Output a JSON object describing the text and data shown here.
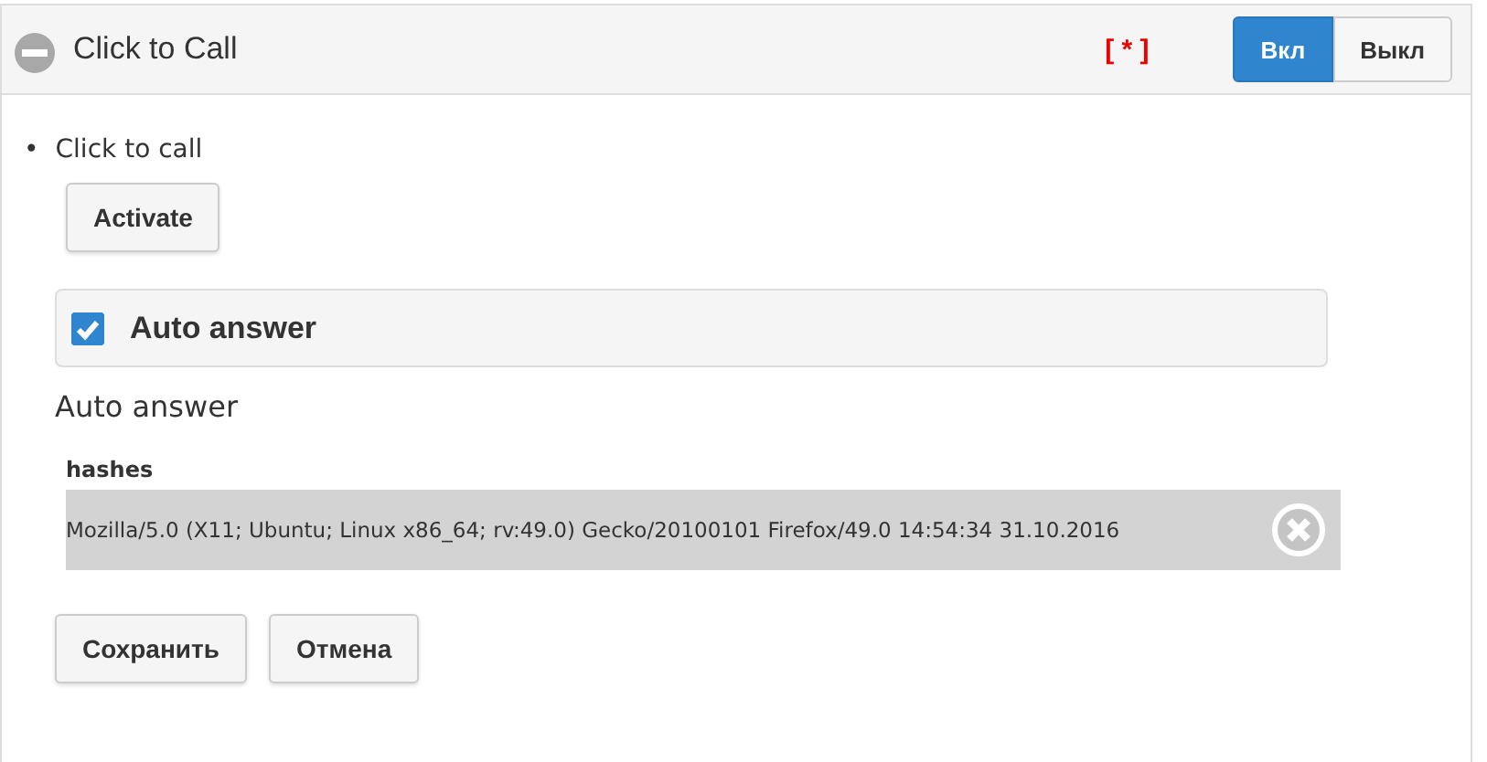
{
  "panel": {
    "title": "Click to Call",
    "marker": "[ * ]",
    "toggle": [
      {
        "label": "Вкл",
        "selected": true
      },
      {
        "label": "Выкл",
        "selected": false
      }
    ]
  },
  "list_item": {
    "bullet": "•",
    "text": "Click to call"
  },
  "activate_button": "Activate",
  "auto_answer": {
    "label": "Auto answer",
    "checked": true
  },
  "section_title": "Auto answer",
  "hashes": {
    "label": "hashes",
    "rows": [
      {
        "text": "Mozilla/5.0 (X11; Ubuntu; Linux x86_64; rv:49.0) Gecko/20100101 Firefox/49.0 14:54:34 31.10.2016"
      }
    ]
  },
  "buttons": [
    "Сохранить",
    "Отмена"
  ]
}
